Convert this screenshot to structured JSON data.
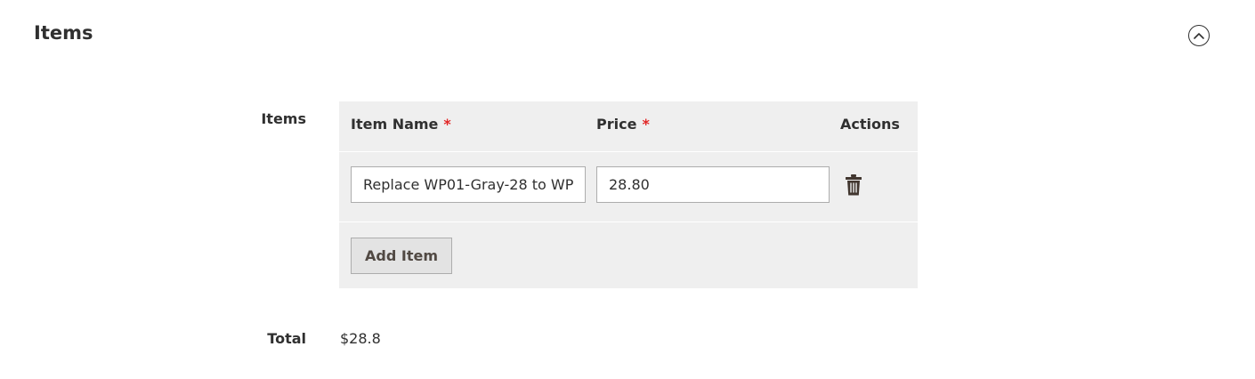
{
  "section": {
    "title": "Items",
    "toggle_icon": "chevron-up-icon"
  },
  "items_field": {
    "label": "Items",
    "columns": {
      "name": "Item Name",
      "price": "Price",
      "actions": "Actions",
      "required_marker": "*"
    },
    "rows": [
      {
        "name": "Replace WP01-Gray-28 to WP",
        "price": "28.80",
        "delete_icon": "trash-icon"
      }
    ],
    "add_button_label": "Add Item"
  },
  "total": {
    "label": "Total",
    "value": "$28.8"
  },
  "colors": {
    "required": "#e22626",
    "grid_background": "#efefef",
    "text": "#303030"
  }
}
